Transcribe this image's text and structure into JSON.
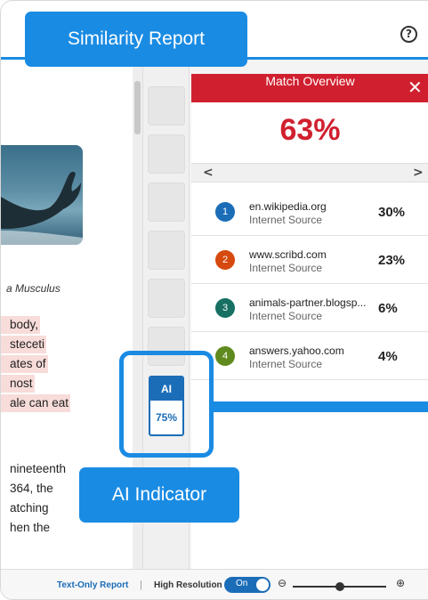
{
  "app": {
    "help_icon": "question-circle-icon",
    "colors": {
      "accent": "#1a8be3",
      "header_red": "#d0202f",
      "ai_blue": "#1b6db8",
      "highlight": "#f7dcd9"
    }
  },
  "callouts": {
    "similarity_report": "Similarity Report",
    "ai_indicator": "AI Indicator"
  },
  "document": {
    "caption": "a Musculus",
    "lines": [
      "body,",
      "steceti",
      "ates of",
      "nost",
      "ale can eat",
      "nineteenth",
      "364, the",
      "atching",
      "hen the"
    ]
  },
  "ai_badge": {
    "label": "AI",
    "value": "75%"
  },
  "match_overview": {
    "title": "Match Overview",
    "close_icon": "close-icon",
    "overall": "63%",
    "prev": "<",
    "next": ">",
    "matches": [
      {
        "num": "1",
        "domain": "en.wikipedia.org",
        "type": "Internet Source",
        "pct": "30%",
        "color": "#1b6db8"
      },
      {
        "num": "2",
        "domain": "www.scribd.com",
        "type": "Internet Source",
        "pct": "23%",
        "color": "#d6490f"
      },
      {
        "num": "3",
        "domain": "animals-partner.blogsp...",
        "type": "Internet Source",
        "pct": "6%",
        "color": "#177062"
      },
      {
        "num": "4",
        "domain": "answers.yahoo.com",
        "type": "Internet Source",
        "pct": "4%",
        "color": "#5f8a1d"
      }
    ]
  },
  "footer": {
    "text_only": "Text-Only Report",
    "separator": "|",
    "high_res": "High Resolution",
    "toggle": "On",
    "zoom_out_icon": "zoom-out-icon",
    "zoom_in_icon": "zoom-in-icon"
  }
}
